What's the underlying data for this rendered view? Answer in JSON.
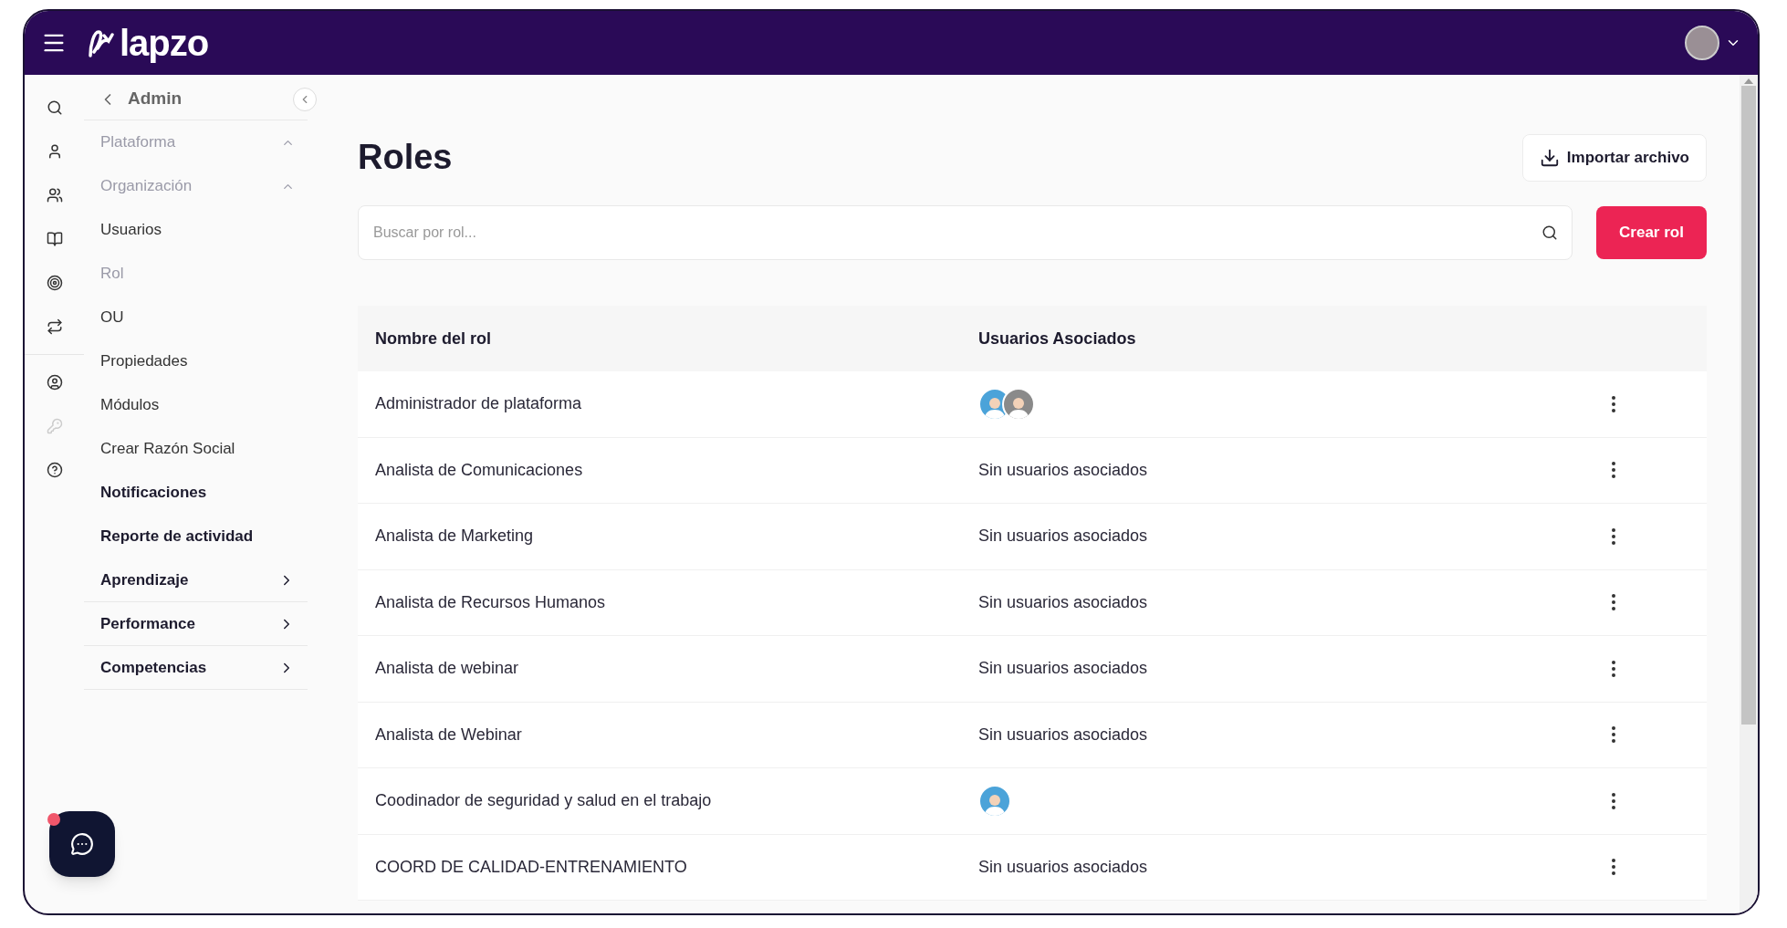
{
  "header": {
    "logo": "lapzo"
  },
  "nav": {
    "back_label": "Admin",
    "items": [
      {
        "label": "Plataforma",
        "kind": "group",
        "expanded": true,
        "faded": true,
        "bold": false
      },
      {
        "label": "Organización",
        "kind": "group",
        "expanded": true,
        "faded": true,
        "bold": false
      },
      {
        "label": "Usuarios",
        "kind": "item",
        "faded": false,
        "bold": false
      },
      {
        "label": "Rol",
        "kind": "item",
        "faded": true,
        "bold": false
      },
      {
        "label": "OU",
        "kind": "item",
        "faded": false,
        "bold": false
      },
      {
        "label": "Propiedades",
        "kind": "item",
        "faded": false,
        "bold": false
      },
      {
        "label": "Módulos",
        "kind": "item",
        "faded": false,
        "bold": false
      },
      {
        "label": "Crear Razón Social",
        "kind": "item",
        "faded": false,
        "bold": false
      },
      {
        "label": "Notificaciones",
        "kind": "item",
        "faded": false,
        "bold": true
      },
      {
        "label": "Reporte de actividad",
        "kind": "item",
        "faded": false,
        "bold": true
      },
      {
        "label": "Aprendizaje",
        "kind": "group",
        "expanded": false,
        "faded": false,
        "bold": true
      },
      {
        "label": "Performance",
        "kind": "group",
        "expanded": false,
        "faded": false,
        "bold": true
      },
      {
        "label": "Competencias",
        "kind": "group",
        "expanded": false,
        "faded": false,
        "bold": true
      }
    ]
  },
  "page": {
    "title": "Roles",
    "import_button": "Importar archivo",
    "search": {
      "placeholder": "Buscar por rol..."
    },
    "create_button": "Crear rol"
  },
  "table": {
    "columns": [
      "Nombre del rol",
      "Usuarios Asociados"
    ],
    "rows": [
      {
        "name": "Administrador de plataforma",
        "avatars": [
          {
            "color": "#4ba3d9"
          },
          {
            "color": "#8a8a8a"
          }
        ]
      },
      {
        "name": "Analista de Comunicaciones",
        "users_text": "Sin usuarios asociados"
      },
      {
        "name": "Analista de Marketing",
        "users_text": "Sin usuarios asociados"
      },
      {
        "name": "Analista de Recursos Humanos",
        "users_text": "Sin usuarios asociados"
      },
      {
        "name": "Analista de webinar",
        "users_text": "Sin usuarios asociados"
      },
      {
        "name": "Analista de Webinar",
        "users_text": "Sin usuarios asociados"
      },
      {
        "name": "Coodinador de seguridad y salud en el trabajo",
        "avatars": [
          {
            "color": "#4ba3d9"
          }
        ]
      },
      {
        "name": "COORD DE CALIDAD-ENTRENAMIENTO",
        "users_text": "Sin usuarios asociados"
      }
    ]
  },
  "chat": {
    "notification": true
  }
}
